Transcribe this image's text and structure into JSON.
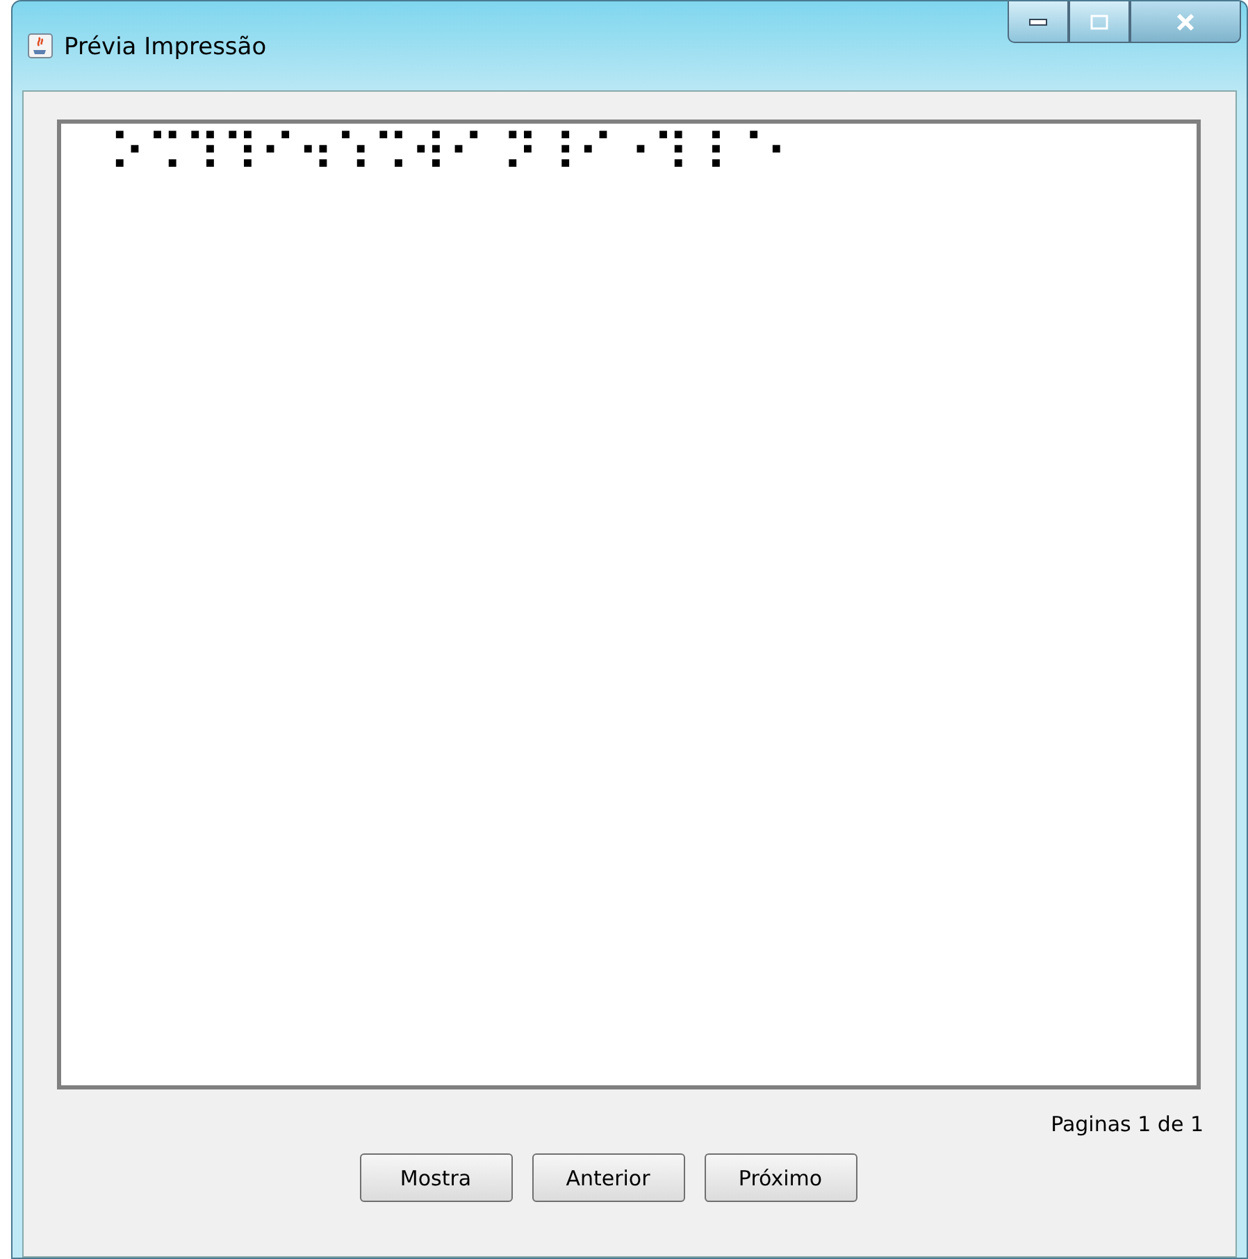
{
  "window": {
    "title": "Prévia Impressão"
  },
  "preview": {
    "braille_lines": [
      "⠕⠩⠹⠹⠊⠲⠱⠩⠺⠊ ⠝⠸⠊⠐⠹⠸⠈⠂"
    ]
  },
  "page_indicator": "Paginas 1 de 1",
  "buttons": [
    "Mostra",
    "Anterior",
    "Próximo"
  ]
}
